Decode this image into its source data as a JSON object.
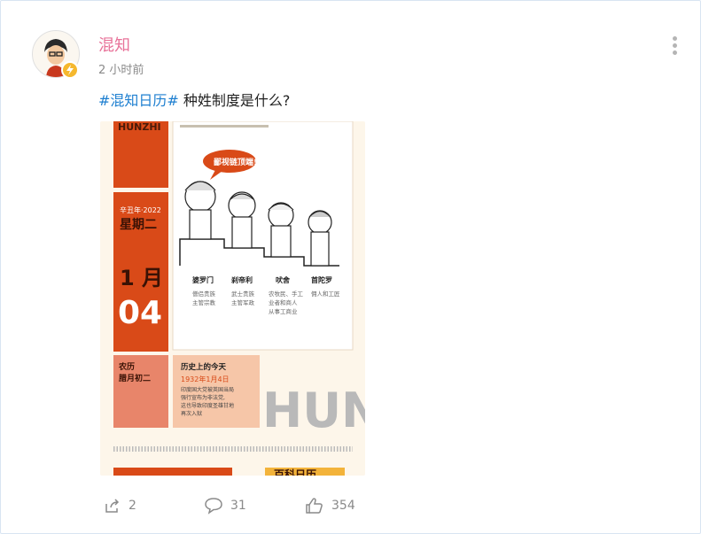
{
  "post": {
    "author": "混知",
    "time": "2 小时前",
    "hashtag": "#混知日历#",
    "text": " 种姓制度是什么?"
  },
  "image": {
    "brand": "HUNZHI",
    "year_line": "辛丑年·2022",
    "weekday": "星期二",
    "month": "1 月",
    "day": "04",
    "lunar_label": "农历",
    "lunar_date": "腊月初二",
    "history_title": "历史上的今天",
    "history_date": "1932年1月4日",
    "history_body": [
      "印度国大党被英国当局",
      "强行宣布为非法党,",
      "这也导致印度圣雄甘地",
      "再次入狱"
    ],
    "speech": "鄙视链顶端!",
    "castes": [
      {
        "name": "婆罗门",
        "desc": [
          "僧侣贵族",
          "主管宗教"
        ]
      },
      {
        "name": "刹帝利",
        "desc": [
          "武士贵族",
          "主管军政"
        ]
      },
      {
        "name": "吠舍",
        "desc": [
          "农牧民、手工",
          "业者和商人",
          "从事工商业"
        ]
      },
      {
        "name": "首陀罗",
        "desc": [
          "佣人和工匠"
        ]
      }
    ],
    "big_watermark": "HUN",
    "bottom_label": "百科日历"
  },
  "actions": {
    "share_count": "2",
    "comment_count": "31",
    "like_count": "354"
  },
  "colors": {
    "accent_orange": "#d94a18",
    "salmon": "#e8856a",
    "tag_blue": "#1e7fd0",
    "author_pink": "#e8739a"
  }
}
